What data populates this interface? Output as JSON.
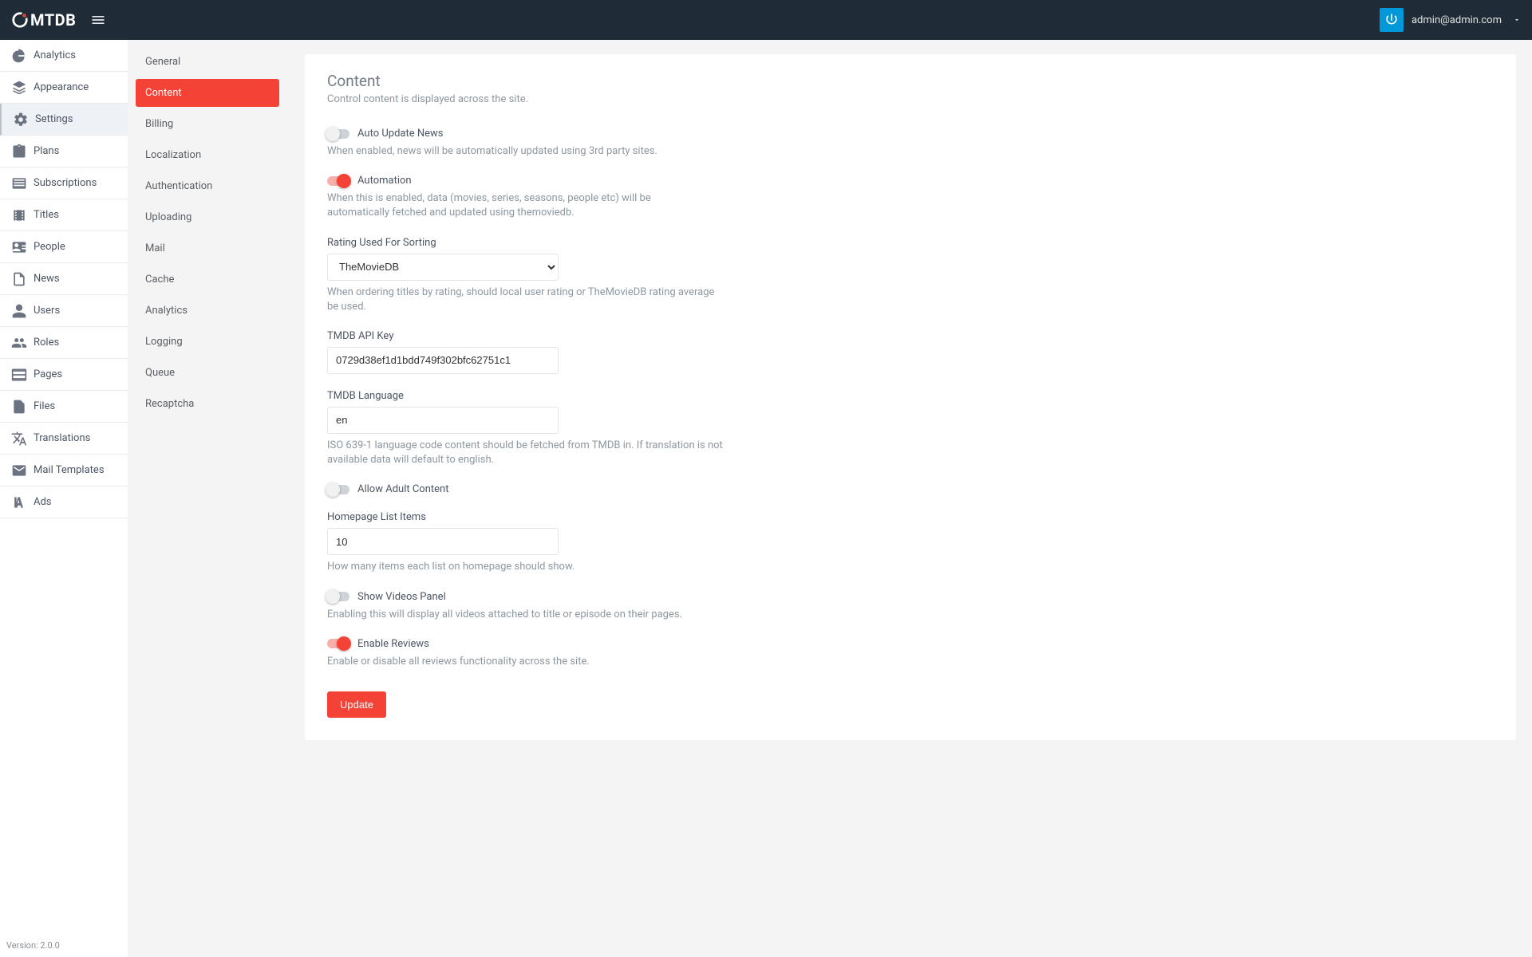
{
  "app": {
    "name": "MTDB"
  },
  "header": {
    "user_email": "admin@admin.com"
  },
  "sidebar": {
    "items": [
      {
        "label": "Analytics",
        "icon": "pie"
      },
      {
        "label": "Appearance",
        "icon": "layers"
      },
      {
        "label": "Settings",
        "icon": "gear",
        "active": true
      },
      {
        "label": "Plans",
        "icon": "clipboard"
      },
      {
        "label": "Subscriptions",
        "icon": "subs"
      },
      {
        "label": "Titles",
        "icon": "film"
      },
      {
        "label": "People",
        "icon": "badge"
      },
      {
        "label": "News",
        "icon": "doc"
      },
      {
        "label": "Users",
        "icon": "person"
      },
      {
        "label": "Roles",
        "icon": "group"
      },
      {
        "label": "Pages",
        "icon": "page"
      },
      {
        "label": "Files",
        "icon": "file"
      },
      {
        "label": "Translations",
        "icon": "translate"
      },
      {
        "label": "Mail Templates",
        "icon": "mail"
      },
      {
        "label": "Ads",
        "icon": "ads"
      }
    ],
    "version_label": "Version: 2.0.0"
  },
  "settings_tabs": [
    "General",
    "Content",
    "Billing",
    "Localization",
    "Authentication",
    "Uploading",
    "Mail",
    "Cache",
    "Analytics",
    "Logging",
    "Queue",
    "Recaptcha"
  ],
  "settings_active_tab": "Content",
  "page": {
    "title": "Content",
    "subtitle": "Control content is displayed across the site.",
    "auto_update_news": {
      "label": "Auto Update News",
      "help": "When enabled, news will be automatically updated using 3rd party sites.",
      "on": false
    },
    "automation": {
      "label": "Automation",
      "help": "When this is enabled, data (movies, series, seasons, people etc) will be automatically fetched and updated using themoviedb.",
      "on": true
    },
    "rating_sort": {
      "label": "Rating Used For Sorting",
      "value": "TheMovieDB",
      "help": "When ordering titles by rating, should local user rating or TheMovieDB rating average be used."
    },
    "tmdb_key": {
      "label": "TMDB API Key",
      "value": "0729d38ef1d1bdd749f302bfc62751c1"
    },
    "tmdb_lang": {
      "label": "TMDB Language",
      "value": "en",
      "help": "ISO 639-1 language code content should be fetched from TMDB in. If translation is not available data will default to english."
    },
    "allow_adult": {
      "label": "Allow Adult Content",
      "on": false
    },
    "homepage_items": {
      "label": "Homepage List Items",
      "value": "10",
      "help": "How many items each list on homepage should show."
    },
    "show_videos": {
      "label": "Show Videos Panel",
      "help": "Enabling this will display all videos attached to title or episode on their pages.",
      "on": false
    },
    "enable_reviews": {
      "label": "Enable Reviews",
      "help": "Enable or disable all reviews functionality across the site.",
      "on": true
    },
    "update_button": "Update"
  }
}
